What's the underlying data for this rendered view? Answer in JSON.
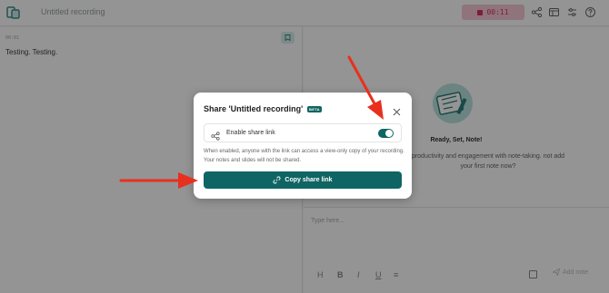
{
  "topbar": {
    "recording_title": "Untitled recording",
    "timer": "00:11",
    "icons": [
      "share-icon",
      "layout-icon",
      "sliders-icon",
      "help-icon"
    ]
  },
  "transcript": {
    "timestamp": "00:01",
    "note": "Testing. Testing."
  },
  "empty_state": {
    "heading": "Ready, Set, Note!",
    "subtext": "productivity and engagement with note-taking. not add your first note now?"
  },
  "editor": {
    "placeholder": "Type here...",
    "format_buttons": [
      "H",
      "B",
      "I",
      "U",
      "≡"
    ],
    "add_note_label": "Add note"
  },
  "modal": {
    "title": "Share 'Untitled recording'",
    "badge": "BETA",
    "toggle_label": "Enable share link",
    "toggle_on": true,
    "description": "When enabled, anyone with the link can access a view-only copy of your recording. Your notes and slides will not be shared.",
    "copy_button": "Copy share link"
  },
  "colors": {
    "accent": "#0f6563",
    "timer_bg": "#f6c9d5",
    "timer_fg": "#d6336c",
    "annotation_arrow": "#e8301e"
  }
}
